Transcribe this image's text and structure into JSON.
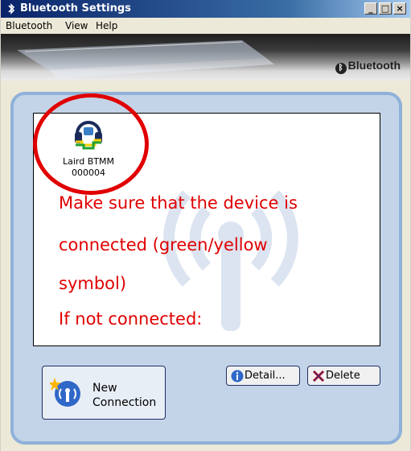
{
  "window": {
    "title": "Bluetooth Settings",
    "controls": [
      "minimize",
      "maximize",
      "close"
    ]
  },
  "menu": {
    "items": [
      "Bluetooth",
      "View",
      "Help"
    ]
  },
  "banner": {
    "brand": "Bluetooth"
  },
  "device": {
    "name_line1": "Laird BTMM",
    "name_line2": "000004",
    "icon": "headphones-connected-icon"
  },
  "annotation": {
    "lines": [
      "Make sure that the device is",
      "connected (green/yellow",
      "symbol)",
      "If not connected:"
    ],
    "color": "#e00000"
  },
  "buttons": {
    "new_connection_line1": "New",
    "new_connection_line2": "Connection",
    "detail": "Detail...",
    "delete": "Delete"
  },
  "colors": {
    "titlebar": "#0a246a",
    "frame": "#8fb1d9",
    "annotation": "#e00000"
  }
}
